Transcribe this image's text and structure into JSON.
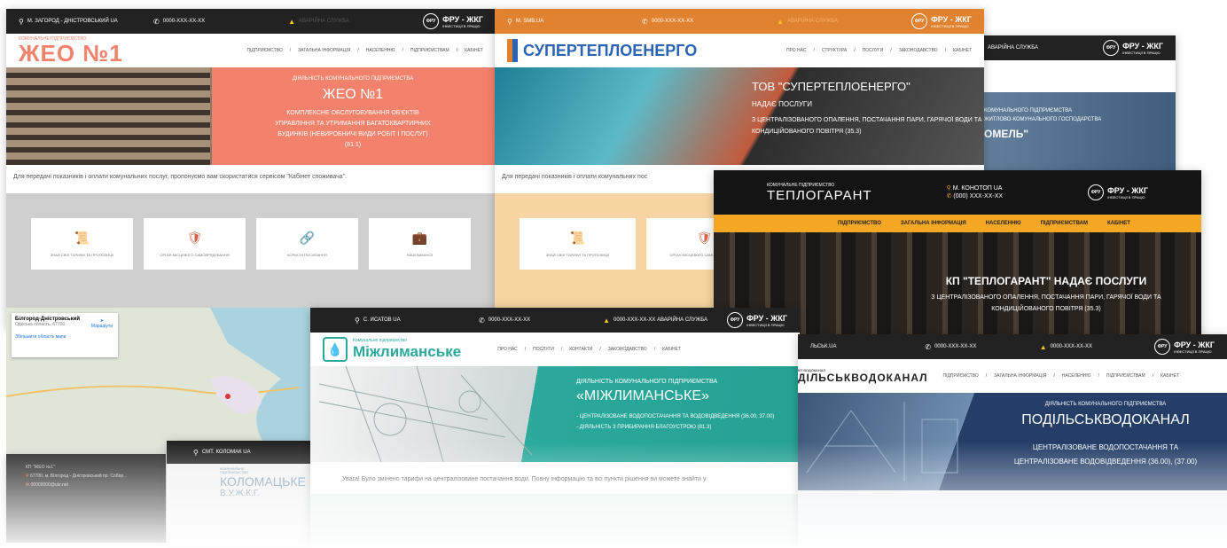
{
  "colors": {
    "zheo": "#f3826c",
    "orange": "#e0822f",
    "teal": "#2aa99c",
    "dark": "#222222",
    "navy": "#243e68",
    "yellow": "#f5a623"
  },
  "fru": {
    "title": "ФРУ - ЖКГ",
    "subtitle": "ІНВЕСТИЦІЇ В ПРАЦЮ",
    "badge": "ФРУ"
  },
  "zheo": {
    "top": {
      "address": "М. ЗАГОРОД - ДНІСТРОВСЬКИЙ UA",
      "phone": "0000-XXX-XX-XX",
      "alert": "АВАРІЙНА СЛУЖБА"
    },
    "logo_small": "КОМУНАЛЬНЕ ПІДПРИЄМСТВО",
    "logo": "ЖЕО №1",
    "menu": [
      "ПІДПРИЄМСТВО",
      "/",
      "ЗАГАЛЬНА ІНФОРМАЦІЯ",
      "/",
      "НАСЕЛЕННЮ",
      "/",
      "ПІДПРИЄМСТВАМ",
      "/",
      "КАБІНЕТ"
    ],
    "hero_small": "ДІЯЛЬНІСТЬ КОМУНАЛЬНОГО ПІДПРИЄМСТВА",
    "hero_title": "ЖЕО №1",
    "hero_text": "КОМПЛЕКСНЕ ОБСЛУГОВУВАННЯ ОБ'ЄКТІВ УПРАВЛІННЯ ТА УТРИМАННЯ БАГАТОКВАРТИРНИХ БУДИНКІВ (НЕВИРОБНИЧІ ВИДИ РОБІТ І ПОСЛУГ) (81.1)",
    "notice": "Для передачі показників і оплати комунальних послуг, пропонуємо вам скористатися сервісом \"Кабінет споживача\".",
    "tiles": [
      "ЗНАЙ СВОЇ ТАРИФИ ТА ПРОПОЗИЦІЇ",
      "ОРГАН МІСЦЕВОГО САМОВРЯДУВАННЯ",
      "КОРИСНІ ПОСИЛАННЯ",
      "НАШІ ВАКАНСІЇ"
    ]
  },
  "super": {
    "top": {
      "address": "М. SMB.UA",
      "phone": "0000-XXX-XX-XX",
      "alert": "АВАРІЙНА СЛУЖБА"
    },
    "logo": "СУПЕРТЕПЛОЕНЕРГО",
    "menu": [
      "ПРО НАС",
      "/",
      "СТРУКТУРА",
      "/",
      "ПОСЛУГИ",
      "/",
      "ЗАКОНОДАВСТВО",
      "/",
      "КАБІНЕТ"
    ],
    "hero_title": "ТОВ \"СУПЕРТЕПЛОЕНЕРГО\"",
    "hero_sub": "НАДАЄ ПОСЛУГИ",
    "hero_text": "З ЦЕНТРАЛІЗОВАНОГО ОПАЛЕННЯ, ПОСТАЧАННЯ ПАРИ, ГАРЯЧОЇ ВОДИ ТА КОНДИЦІЙОВАНОГО ПОВІТРЯ (35.3)",
    "notice": "Для передачі показників і оплати комунальних пос",
    "tiles": [
      "ЗНАЙ СВОЇ ТАРИФИ ТА ПРОПОЗИЦІЇ",
      "ОРГАН МІСЦЕВОГО САМОВРЯДУВАННЯ"
    ]
  },
  "gomel": {
    "top": {
      "alert": "АВАРІЙНА СЛУЖБА"
    },
    "hero_small": "КОМУНАЛЬНОГО ПІДПРИЄМСТВА",
    "hero_line2": "ЖИТЛОВО-КОМУНАЛЬНОГО ГОСПОДАРСТВА",
    "hero_title": "ОМЕЛЬ\""
  },
  "teplo": {
    "logo_small": "КОМУНАЛЬНЕ ПІДПРИЄМСТВО",
    "logo": "ТЕПЛОГАРАНТ",
    "address": "М. КОНОТОП UA",
    "phone": "(000) XXX-XX-XX",
    "menu": [
      "ПІДПРИЄМСТВО",
      "ЗАГАЛЬНА ІНФОРМАЦІЯ",
      "НАСЕЛЕННЮ",
      "ПІДПРИЄМСТВАМ",
      "КАБІНЕТ"
    ],
    "hero_title": "КП \"ТЕПЛОГАРАНТ\" НАДАЄ ПОСЛУГИ",
    "hero_text": "З ЦЕНТРАЛІЗОВАНОГО ОПАЛЕННЯ, ПОСТАЧАННЯ ПАРИ, ГАРЯЧОЇ ВОДИ ТА КОНДИЦІЙОВАНОГО ПОВІТРЯ (35.3)"
  },
  "map": {
    "place": "Білгород-Дністровський",
    "region": "Одеська область, 67700",
    "link": "Збільшити область мапи",
    "route": "Маршрути",
    "footer_email": "КП \"ЖЕО №1\"",
    "footer_addr": "67700, м. Білгород - Дністровський пр. Собор...",
    "footer_phone": "00000000@ukr.net"
  },
  "kolomak": {
    "top": {
      "address": "СМТ. КОЛОМАК UA"
    },
    "logo_small": "КОМУНАЛЬНЕ ПІДПРИЄМСТВО",
    "logo": "КОЛОМАЦЬКЕ",
    "logo2": "В.У.Ж.К.Г."
  },
  "mizh": {
    "top": {
      "address": "С. ИСАТОВ UA",
      "phone": "0000-XXX-XX-XX",
      "alert": "0000-XXX-XX-XX  АВАРІЙНА СЛУЖБА"
    },
    "logo_small": "Комунальне підприємство",
    "logo": "Міжлиманське",
    "menu": [
      "ПРО НАС",
      "/",
      "ПОСЛУГИ",
      "/",
      "КОНТАКТИ",
      "/",
      "ЗАКОНОДАВСТВО",
      "/",
      "КАБІНЕТ"
    ],
    "hero_small": "ДІЯЛЬНІСТЬ КОМУНАЛЬНОГО ПІДПРИЄМСТВА",
    "hero_title": "«МІЖЛИМАНСЬКЕ»",
    "hero_line1": "- ЦЕНТРАЛІЗОВАНЕ ВОДОПОСТАЧАННЯ ТА ВОДОВІДВЕДЕННЯ (36.00, 37.00)",
    "hero_line2": "- ДІЯЛЬНІСТЬ З ПРИБИРАННЯ БЛАГОУСТРОЮ (81.3)",
    "notice": "Увага! Було змінено тарифи на централізоване постачання води. Повну інформацію та всі пункти рішення ви можете знайти у"
  },
  "podil": {
    "top": {
      "address": "ЛЬСЬК.UA",
      "phone": "0000-XXX-XX-XX",
      "alert": "0000-XXX-XX-XX"
    },
    "logo_small": "КП ВОДОКАНАЛ",
    "logo": "ДІЛЬСЬКВОДОКАНАЛ",
    "menu": [
      "ПІДПРИЄМСТВО",
      "/",
      "ЗАГАЛЬНА ІНФОРМАЦІЯ",
      "/",
      "НАСЕЛЕННЮ",
      "/",
      "ПІДПРИЄМСТВАМ",
      "/",
      "КАБІНЕТ"
    ],
    "hero_small": "ДІЯЛЬНІСТЬ КОМУНАЛЬНОГО ПІДПРИЄМСТВА",
    "hero_title": "ПОДІЛЬСЬКВОДОКАНАЛ",
    "hero_text": "ЦЕНТРАЛІЗОВАНЕ ВОДОПОСТАЧАННЯ ТА ЦЕНТРАЛІЗОВАНЕ ВОДОВІДВЕДЕННЯ (36.00), (37.00)"
  }
}
